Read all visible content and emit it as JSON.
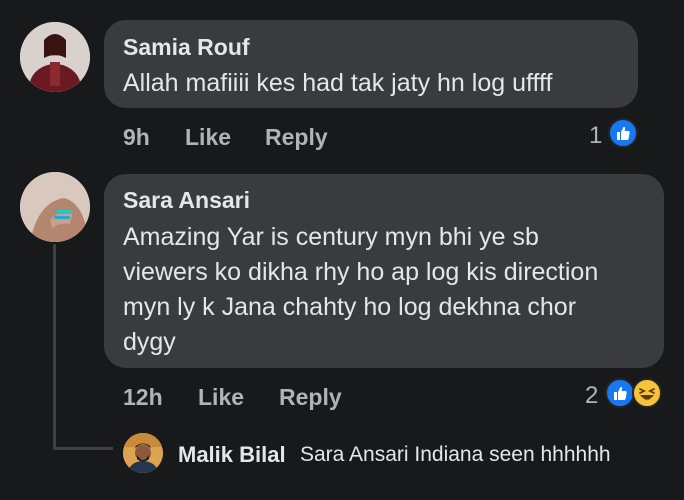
{
  "comments": [
    {
      "author": "Samia Rouf",
      "text": "Allah mafiiii kes had tak jaty hn log uffff",
      "time": "9h",
      "like_label": "Like",
      "reply_label": "Reply",
      "reaction_count": "1",
      "reactions": [
        "like-icon"
      ]
    },
    {
      "author": "Sara Ansari",
      "text": "Amazing Yar is century myn bhi ye sb viewers ko dikha rhy ho ap log kis direction myn ly k Jana chahty ho log dekhna chor dygy",
      "time": "12h",
      "like_label": "Like",
      "reply_label": "Reply",
      "reaction_count": "2",
      "reactions": [
        "like-icon",
        "haha-icon"
      ]
    }
  ],
  "reply_preview": {
    "author": "Malik Bilal",
    "text": "Sara Ansari Indiana seen hhhhhh"
  },
  "colors": {
    "background": "#18191a",
    "bubble": "#3a3b3c",
    "text": "#e4e6eb",
    "muted": "#b0b3b8",
    "like_blue": "#1877f2",
    "haha_yellow": "#f7c33b"
  }
}
